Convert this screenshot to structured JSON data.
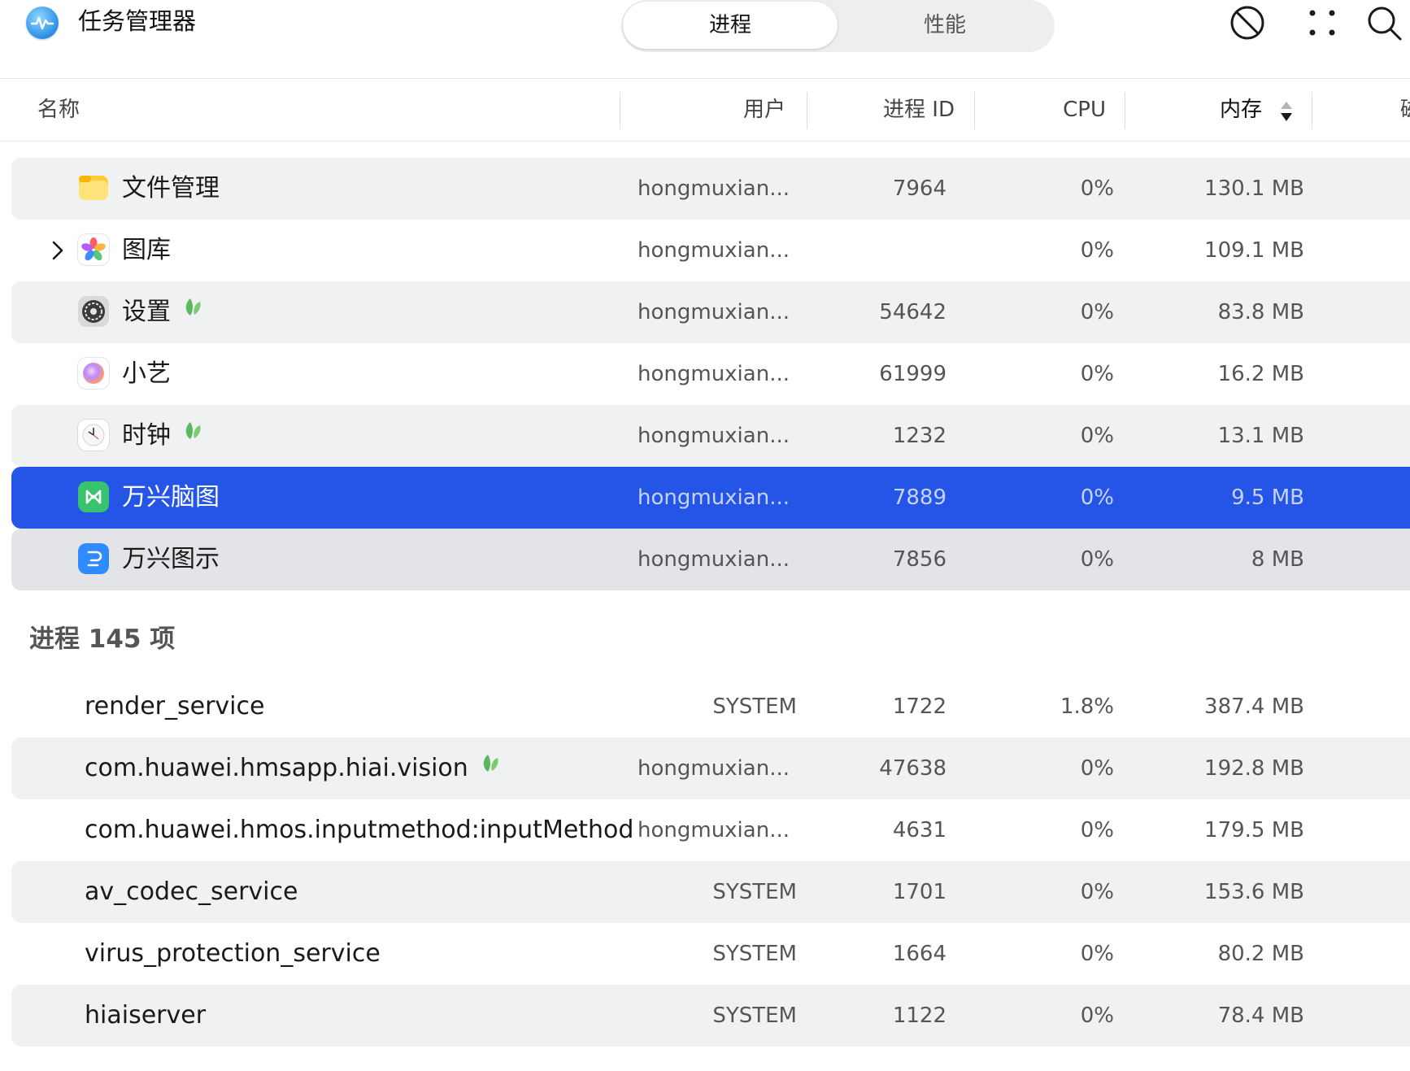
{
  "app": {
    "title": "任务管理器",
    "logo_icon": "task-manager-logo-icon"
  },
  "tabs": [
    {
      "label": "进程",
      "active": true
    },
    {
      "label": "性能",
      "active": false
    }
  ],
  "toolbar": {
    "icons": [
      "stop-process-icon",
      "more-options-icon",
      "search-icon"
    ]
  },
  "table": {
    "columns": {
      "name": "名称",
      "user": "用户",
      "pid": "进程 ID",
      "cpu": "CPU",
      "memory": "内存",
      "disk_partial": "磁"
    },
    "sorted_by": "内存"
  },
  "apps": [
    {
      "name": "文件管理",
      "icon": "file-manager-icon",
      "user": "hongmuxian...",
      "pid": "7964",
      "cpu": "0%",
      "memory": "130.1 MB",
      "eco": false,
      "expandable": false
    },
    {
      "name": "图库",
      "icon": "gallery-icon",
      "user": "hongmuxian...",
      "pid": "",
      "cpu": "0%",
      "memory": "109.1 MB",
      "eco": false,
      "expandable": true
    },
    {
      "name": "设置",
      "icon": "settings-icon",
      "user": "hongmuxian...",
      "pid": "54642",
      "cpu": "0%",
      "memory": "83.8 MB",
      "eco": true,
      "expandable": false
    },
    {
      "name": "小艺",
      "icon": "xiaoyi-assistant-icon",
      "user": "hongmuxian...",
      "pid": "61999",
      "cpu": "0%",
      "memory": "16.2 MB",
      "eco": false,
      "expandable": false
    },
    {
      "name": "时钟",
      "icon": "clock-icon",
      "user": "hongmuxian...",
      "pid": "1232",
      "cpu": "0%",
      "memory": "13.1 MB",
      "eco": true,
      "expandable": false
    },
    {
      "name": "万兴脑图",
      "icon": "mindmap-app-icon",
      "user": "hongmuxian...",
      "pid": "7889",
      "cpu": "0%",
      "memory": "9.5 MB",
      "eco": false,
      "expandable": false,
      "selected": true
    },
    {
      "name": "万兴图示",
      "icon": "diagram-app-icon",
      "user": "hongmuxian...",
      "pid": "7856",
      "cpu": "0%",
      "memory": "8 MB",
      "eco": false,
      "expandable": false
    }
  ],
  "processes_section": {
    "title": "进程 145 项"
  },
  "processes": [
    {
      "name": "render_service",
      "user": "SYSTEM",
      "pid": "1722",
      "cpu": "1.8%",
      "memory": "387.4 MB",
      "eco": false
    },
    {
      "name": "com.huawei.hmsapp.hiai.vision",
      "user": "hongmuxian...",
      "pid": "47638",
      "cpu": "0%",
      "memory": "192.8 MB",
      "eco": true
    },
    {
      "name": "com.huawei.hmos.inputmethod:inputMethod",
      "user": "hongmuxian...",
      "pid": "4631",
      "cpu": "0%",
      "memory": "179.5 MB",
      "eco": false
    },
    {
      "name": "av_codec_service",
      "user": "SYSTEM",
      "pid": "1701",
      "cpu": "0%",
      "memory": "153.6 MB",
      "eco": false
    },
    {
      "name": "virus_protection_service",
      "user": "SYSTEM",
      "pid": "1664",
      "cpu": "0%",
      "memory": "80.2 MB",
      "eco": false
    },
    {
      "name": "hiaiserver",
      "user": "SYSTEM",
      "pid": "1122",
      "cpu": "0%",
      "memory": "78.4 MB",
      "eco": false
    }
  ],
  "colors": {
    "accent": "#2455e6",
    "eco_leaf": "#5cb85c",
    "row_alt": "#f0f1f3"
  }
}
